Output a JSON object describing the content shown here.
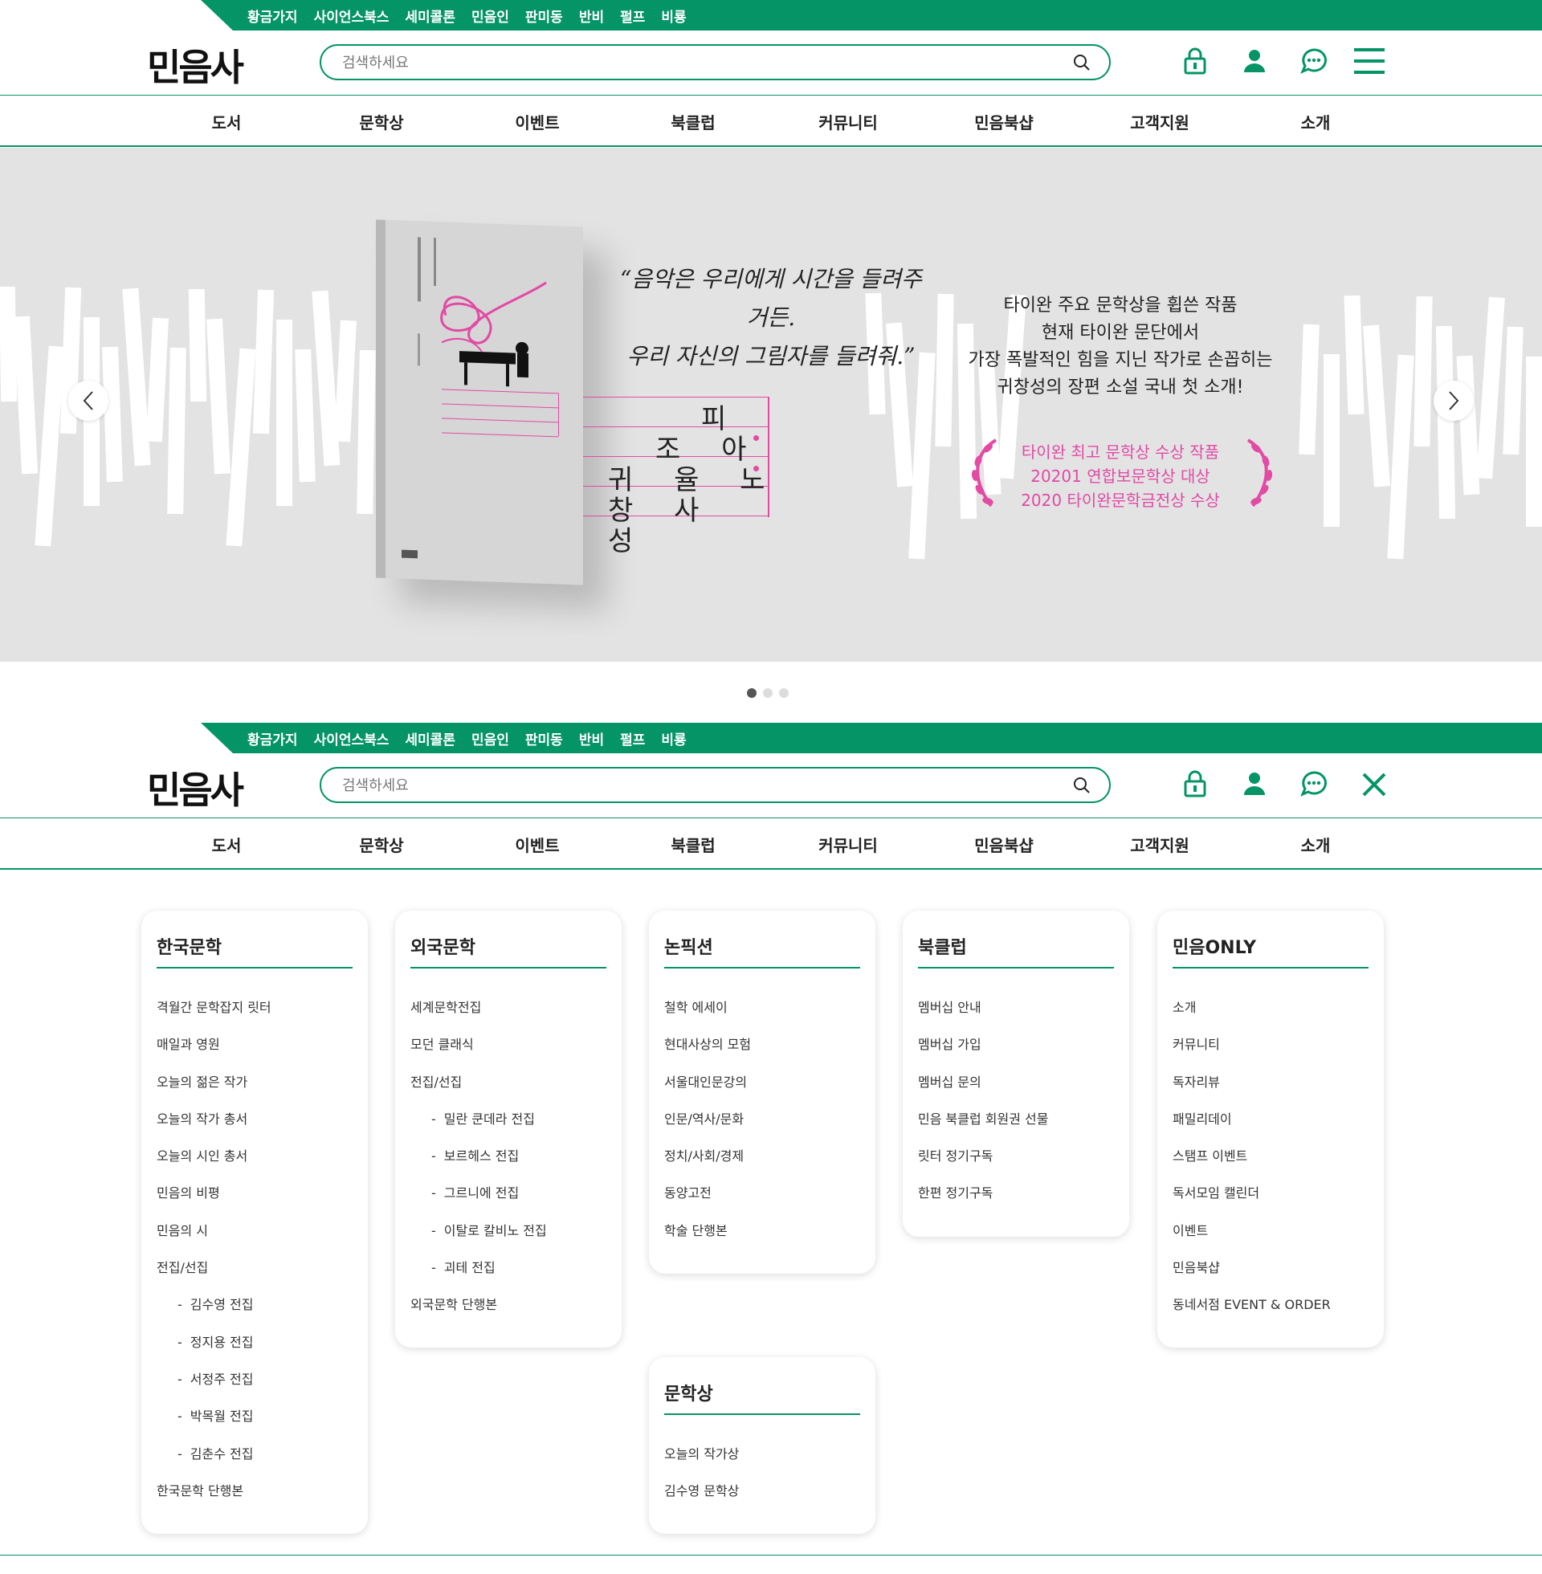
{
  "brand": {
    "logo_text": "민음사",
    "accent": "#049466",
    "highlight": "#e24aa4"
  },
  "topbar_links": [
    "황금가지",
    "사이언스북스",
    "세미콜론",
    "민음인",
    "판미동",
    "반비",
    "펄프",
    "비룡"
  ],
  "search": {
    "placeholder": "검색하세요"
  },
  "header_icons": [
    "lock-icon",
    "user-icon",
    "chat-icon"
  ],
  "main_nav": [
    "도서",
    "문학상",
    "이벤트",
    "북클럽",
    "커뮤니티",
    "민음북샵",
    "고객지원",
    "소개"
  ],
  "banner": {
    "quote": [
      "“음악은 우리에게 시간을 들려주거든.",
      "우리 자신의 그림자를 들려줘.”"
    ],
    "poem_lines": [
      "피",
      "조 아",
      "귀 율 노",
      "창 사",
      "성"
    ],
    "blurb": [
      "타이완 주요 문학상을 휩쓴 작품",
      "현재 타이완 문단에서",
      "가장 폭발적인 힘을 지닌 작가로 손꼽히는",
      "귀창성의 장편 소설 국내 첫 소개!"
    ],
    "awards": [
      "타이완 최고 문학상 수상 작품",
      "20201 연합보문학상 대상",
      "2020 타이완문학금전상 수상"
    ],
    "slide_count": 3,
    "active_slide": 1
  },
  "mega_menu": [
    {
      "title": "한국문학",
      "items": [
        {
          "label": "격월간 문학잡지 릿터",
          "sub": false
        },
        {
          "label": "매일과 영원",
          "sub": false
        },
        {
          "label": "오늘의 젊은 작가",
          "sub": false
        },
        {
          "label": "오늘의 작가 총서",
          "sub": false
        },
        {
          "label": "오늘의 시인 총서",
          "sub": false
        },
        {
          "label": "민음의 비평",
          "sub": false
        },
        {
          "label": "민음의 시",
          "sub": false
        },
        {
          "label": "전집/선집",
          "sub": false
        },
        {
          "label": "김수영 전집",
          "sub": true
        },
        {
          "label": "정지용 전집",
          "sub": true
        },
        {
          "label": "서정주 전집",
          "sub": true
        },
        {
          "label": "박목월 전집",
          "sub": true
        },
        {
          "label": "김춘수 전집",
          "sub": true
        },
        {
          "label": "한국문학 단행본",
          "sub": false
        }
      ]
    },
    {
      "title": "외국문학",
      "items": [
        {
          "label": "세계문학전집",
          "sub": false
        },
        {
          "label": "모던 클래식",
          "sub": false
        },
        {
          "label": "전집/선집",
          "sub": false
        },
        {
          "label": "밀란 쿤데라 전집",
          "sub": true
        },
        {
          "label": "보르헤스 전집",
          "sub": true
        },
        {
          "label": "그르니에 전집",
          "sub": true
        },
        {
          "label": "이탈로 칼비노 전집",
          "sub": true
        },
        {
          "label": "괴테 전집",
          "sub": true
        },
        {
          "label": "외국문학 단행본",
          "sub": false
        }
      ]
    },
    {
      "title": "논픽션",
      "items": [
        {
          "label": "철학 에세이",
          "sub": false
        },
        {
          "label": "현대사상의 모험",
          "sub": false
        },
        {
          "label": "서울대인문강의",
          "sub": false
        },
        {
          "label": "인문/역사/문화",
          "sub": false
        },
        {
          "label": "정치/사회/경제",
          "sub": false
        },
        {
          "label": "동양고전",
          "sub": false
        },
        {
          "label": "학술 단행본",
          "sub": false
        }
      ]
    },
    {
      "title": "북클럽",
      "items": [
        {
          "label": "멤버십 안내",
          "sub": false
        },
        {
          "label": "멤버십 가입",
          "sub": false
        },
        {
          "label": "멤버십 문의",
          "sub": false
        },
        {
          "label": "민음 북클럽 회원권 선물",
          "sub": false
        },
        {
          "label": "릿터 정기구독",
          "sub": false
        },
        {
          "label": "한편 정기구독",
          "sub": false
        }
      ]
    },
    {
      "title": "민음ONLY",
      "items": [
        {
          "label": "소개",
          "sub": false
        },
        {
          "label": "커뮤니티",
          "sub": false
        },
        {
          "label": "독자리뷰",
          "sub": false
        },
        {
          "label": "패밀리데이",
          "sub": false
        },
        {
          "label": "스탬프 이벤트",
          "sub": false
        },
        {
          "label": "독서모임 캘린더",
          "sub": false
        },
        {
          "label": "이벤트",
          "sub": false
        },
        {
          "label": "민음북샵",
          "sub": false
        },
        {
          "label": "동네서점 EVENT & ORDER",
          "sub": false
        }
      ]
    },
    {
      "title": "문학상",
      "items": [
        {
          "label": "오늘의 작가상",
          "sub": false
        },
        {
          "label": "김수영 문학상",
          "sub": false
        }
      ]
    }
  ]
}
